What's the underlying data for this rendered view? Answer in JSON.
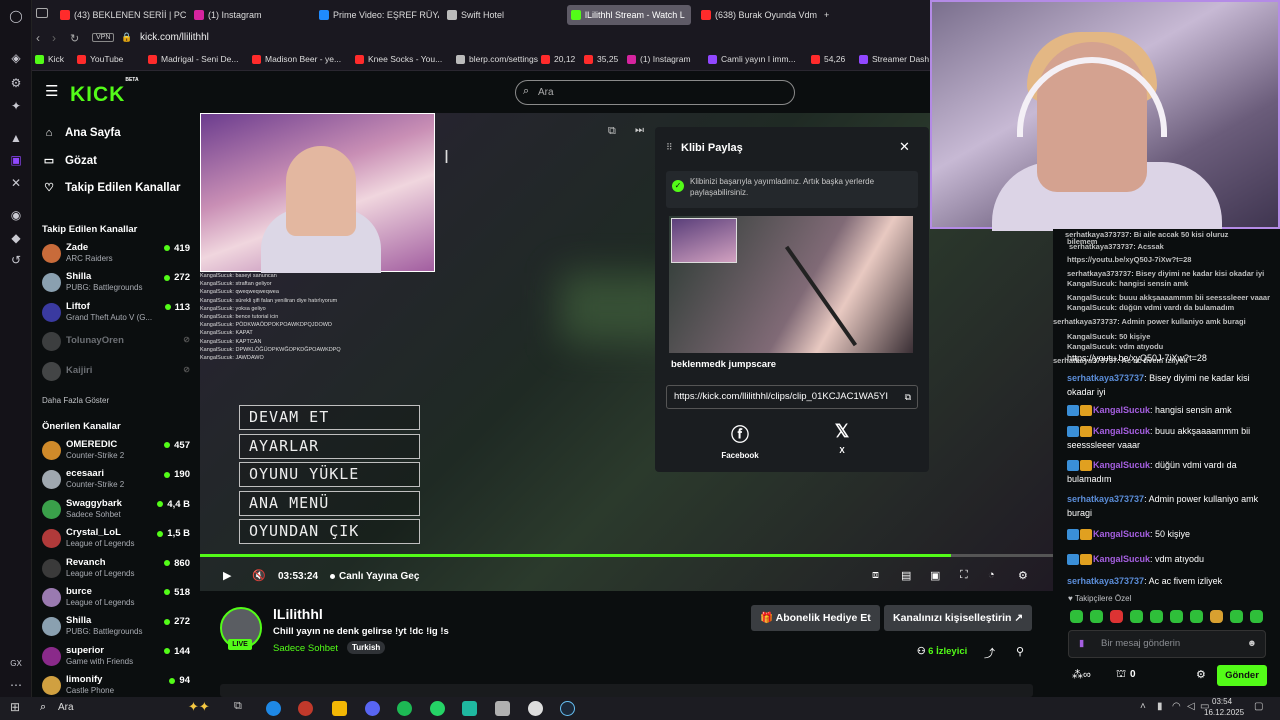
{
  "browser": {
    "tabs": [
      {
        "label": "(43) BEKLENEN SERİİ | PC",
        "color": "#ff2b2b"
      },
      {
        "label": "(1) Instagram",
        "color": "#d6249f"
      },
      {
        "label": "Prime Video: EŞREF RÜYA",
        "color": "#1f8bff"
      },
      {
        "label": "Swift Hotel",
        "color": "#bbbbbb"
      },
      {
        "label": "lLilithhl Stream - Watch L",
        "color": "#53fc18"
      },
      {
        "label": "(638) Burak Oyunda Vdm",
        "color": "#ff2b2b"
      }
    ],
    "add_tab": "+",
    "vpn": "VPN",
    "url": "kick.com/llilithhl",
    "bookmarks": [
      {
        "label": "Kick",
        "color": "#53fc18"
      },
      {
        "label": "YouTube",
        "color": "#ff2b2b"
      },
      {
        "label": "Madrigal - Seni De...",
        "color": "#ff2b2b"
      },
      {
        "label": "Madison Beer - ye...",
        "color": "#ff2b2b"
      },
      {
        "label": "Knee Socks - You...",
        "color": "#ff2b2b"
      },
      {
        "label": "blerp.com/settings",
        "color": "#bbbbbb"
      },
      {
        "label": "20,12",
        "color": "#ff2b2b"
      },
      {
        "label": "35,25",
        "color": "#ff2b2b"
      },
      {
        "label": "(1) Instagram",
        "color": "#d6249f"
      },
      {
        "label": "Camli yayın I imm...",
        "color": "#9147ff"
      },
      {
        "label": "54,26",
        "color": "#ff2b2b"
      },
      {
        "label": "Streamer Dash",
        "color": "#9147ff"
      }
    ]
  },
  "kick": {
    "logo": "KICK",
    "logo_sup": "BETA",
    "search_placeholder": "Ara"
  },
  "sidebar": {
    "nav": [
      {
        "label": "Ana Sayfa",
        "icon": "home-icon"
      },
      {
        "label": "Gözat",
        "icon": "browse-icon"
      },
      {
        "label": "Takip Edilen Kanallar",
        "icon": "heart-icon"
      }
    ],
    "following_title": "Takip Edilen Kanallar",
    "following": [
      {
        "name": "Zade",
        "game": "ARC Raiders",
        "viewers": "419",
        "color": "#c86b3a"
      },
      {
        "name": "Shilla",
        "game": "PUBG: Battlegrounds",
        "viewers": "272",
        "color": "#8aa0b0"
      },
      {
        "name": "Liftof",
        "game": "Grand Theft Auto V (G...",
        "viewers": "113",
        "color": "#3a3aa0"
      },
      {
        "name": "TolunayOren",
        "game": "",
        "viewers": "",
        "color": "#888888"
      },
      {
        "name": "Kaijiri",
        "game": "",
        "viewers": "",
        "color": "#999999"
      }
    ],
    "show_more": "Daha Fazla Göster",
    "recommended_title": "Önerilen Kanallar",
    "recommended": [
      {
        "name": "OMEREDIC",
        "game": "Counter-Strike 2",
        "viewers": "457",
        "color": "#d08a2a"
      },
      {
        "name": "ecesaari",
        "game": "Counter-Strike 2",
        "viewers": "190",
        "color": "#a0a8b0"
      },
      {
        "name": "Swaggybark",
        "game": "Sadece Sohbet",
        "viewers": "4,4 B",
        "color": "#3aa04a"
      },
      {
        "name": "Crystal_LoL",
        "game": "League of Legends",
        "viewers": "1,5 B",
        "color": "#b03a3a"
      },
      {
        "name": "Revanch",
        "game": "League of Legends",
        "viewers": "860",
        "color": "#3a3a3a"
      },
      {
        "name": "burce",
        "game": "League of Legends",
        "viewers": "518",
        "color": "#9a7ab0"
      },
      {
        "name": "Shilla",
        "game": "PUBG: Battlegrounds",
        "viewers": "272",
        "color": "#8aa0b0"
      },
      {
        "name": "superior",
        "game": "Game with Friends",
        "viewers": "144",
        "color": "#8a2a8a"
      },
      {
        "name": "limonify",
        "game": "Castle Phone",
        "viewers": "94",
        "color": "#d0a040"
      }
    ]
  },
  "video": {
    "overlay_chat": [
      "KangalSucuk: baseyi sanuncan",
      "KangalSucuk: straftan geliyor",
      "KangalSucuk: qweqweqweqwea",
      "KangalSucuk: sürekli şifi falan yeniliran diye hatırlıyorum",
      "KangalSucuk: yoksa geliyo",
      "KangalSucuk: bence tutorial icin",
      "KangalSucuk: PÖDKWAÖDPOKPOAWKDPQJDOWD",
      "KangalSucuk: KAPAT",
      "KangalSucuk: KAPTCAN",
      "KangalSucuk: DPWKLÖĞÜOPKWĞOPKDĞPOAWKDPQ",
      "KangalSucuk: JAWDAWO"
    ],
    "game_menu": [
      "DEVAM ET",
      "AYARLAR",
      "OYUNU YÜKLE",
      "ANA MENÜ",
      "OYUNDAN ÇIK"
    ],
    "progress": 0.88,
    "time": "03:53:24",
    "go_live": "Canlı Yayına Geç"
  },
  "clip_panel": {
    "title": "Klibi Paylaş",
    "success": "Klibinizi başarıyla yayımladınız. Artık başka yerlerde paylaşabilirsiniz.",
    "clip_name": "beklenmedk jumpscare",
    "url": "https://kick.com/llilithhl/clips/clip_01KCJAC1WA5YI",
    "share": [
      {
        "label": "Facebook",
        "icon": "facebook-icon"
      },
      {
        "label": "X",
        "icon": "x-icon"
      }
    ]
  },
  "channel": {
    "name": "lLilithhl",
    "title": "Chill yayın ne denk gelirse !yt !dc !ig !s",
    "category": "Sadece Sohbet",
    "tag": "Turkish",
    "live": "LIVE",
    "gift_button": "Abonelik Hediye Et",
    "customize_button": "Kanalınızı kişiselleştirin",
    "viewers_count": "6",
    "viewers_label": "İzleyici"
  },
  "cam_overlay_chat": [
    "serhatkaya373737: Bi aile accak 50 kisi oluruz",
    "bilemem",
    "serhatkaya373737: Acssak",
    "https://youtu.be/xyQ50J-7iXw?t=28",
    "serhatkaya373737: Bisey diyimi ne kadar kisi okadar iyi",
    "KangalSucuk: hangisi sensin amk",
    "KangalSucuk: buuu akkşaaaammm bii seesssleeer vaaar",
    "KangalSucuk: düğün vdmi vardı da bulamadım",
    "serhatkaya373737: Admin power kullaniyo amk buragi",
    "KangalSucuk: 50 kişiye",
    "KangalSucuk: vdm atıyodu",
    "serhatkaya373737: Ac ac fivem izliyek"
  ],
  "chat": {
    "messages": [
      {
        "user": "serhatkaya373737",
        "text": "Bi aile accak 50 kisi oluruz",
        "color": "#5b8dd8",
        "badges": false
      },
      {
        "user": "",
        "text": "https://youtu.be/xyQ50J-7iXw?t=28",
        "color": "#5b8dd8",
        "badges": false
      },
      {
        "user": "serhatkaya373737",
        "text": "Bisey diyimi ne kadar kisi okadar iyi",
        "color": "#5b8dd8",
        "badges": false
      },
      {
        "user": "KangalSucuk",
        "text": "hangisi sensin amk",
        "color": "#a55fe0",
        "badges": true
      },
      {
        "user": "KangalSucuk",
        "text": "buuu akkşaaaammm bii seesssleeer vaaar",
        "color": "#a55fe0",
        "badges": true
      },
      {
        "user": "KangalSucuk",
        "text": "düğün vdmi vardı da bulamadım",
        "color": "#a55fe0",
        "badges": true
      },
      {
        "user": "serhatkaya373737",
        "text": "Admin power kullaniyo amk buragi",
        "color": "#5b8dd8",
        "badges": false
      },
      {
        "user": "KangalSucuk",
        "text": "50 kişiye",
        "color": "#a55fe0",
        "badges": true
      },
      {
        "user": "KangalSucuk",
        "text": "vdm atıyodu",
        "color": "#a55fe0",
        "badges": true
      },
      {
        "user": "serhatkaya373737",
        "text": "Ac ac fivem izliyek",
        "color": "#5b8dd8",
        "badges": false
      }
    ],
    "emote_label": "Takipçilere Özel",
    "input_placeholder": "Bir mesaj gönderin",
    "points": "0",
    "send": "Gönder"
  },
  "taskbar": {
    "search": "Ara",
    "time": "03:54",
    "date": "16.12.2025"
  }
}
